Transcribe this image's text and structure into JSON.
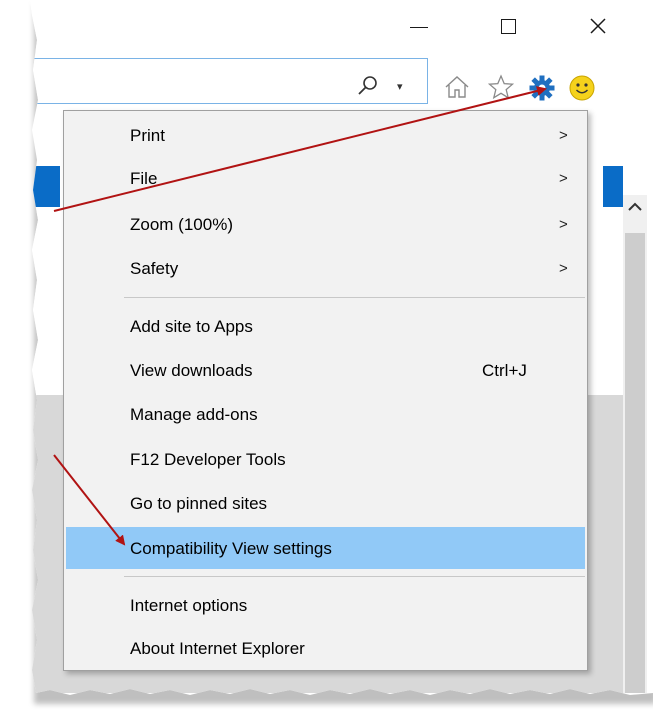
{
  "window": {
    "minimize_label": "—",
    "maximize_label": "☐",
    "close_label": "✕"
  },
  "address_bar": {
    "search_icon": "search-icon",
    "dropdown_glyph": "▾"
  },
  "toolbar_icons": [
    "home-icon",
    "favorites-star-icon",
    "tools-gear-icon",
    "feedback-smiley-icon"
  ],
  "colors": {
    "accent_blue": "#0a6cc7",
    "highlight": "#91c9f7",
    "annotation_arrow": "#b11313",
    "gear_blue": "#1f6fc0",
    "smiley_yellow": "#f5d21c"
  },
  "menu": {
    "items": [
      {
        "label": "Print",
        "submenu": true
      },
      {
        "label": "File",
        "submenu": true
      },
      {
        "label": "Zoom (100%)",
        "submenu": true
      },
      {
        "label": "Safety",
        "submenu": true
      },
      {
        "label": "Add site to Apps"
      },
      {
        "label": "View downloads",
        "shortcut": "Ctrl+J"
      },
      {
        "label": "Manage add-ons"
      },
      {
        "label": "F12 Developer Tools"
      },
      {
        "label": "Go to pinned sites"
      },
      {
        "label": "Compatibility View settings",
        "highlighted": true
      },
      {
        "label": "Internet options"
      },
      {
        "label": "About Internet Explorer"
      }
    ],
    "submenu_arrow": ">"
  }
}
